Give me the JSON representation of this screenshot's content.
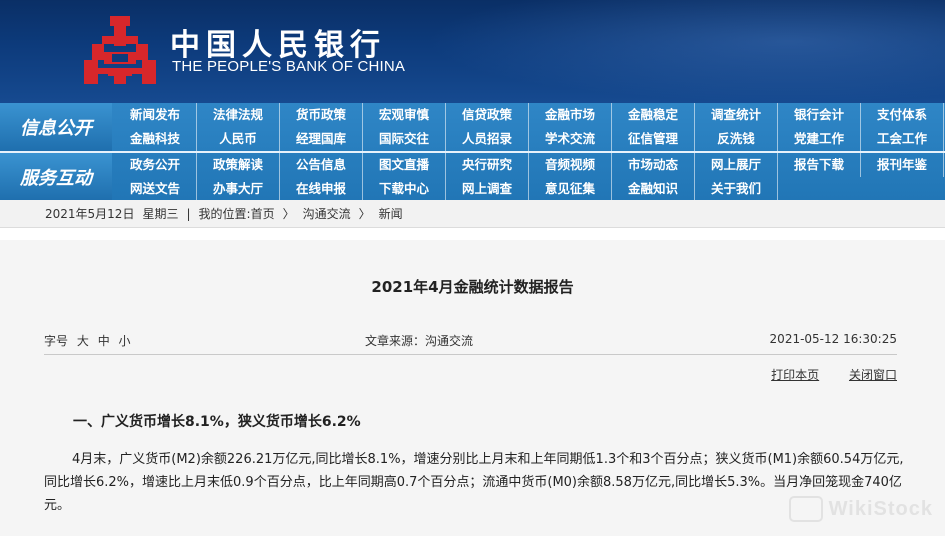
{
  "brand": {
    "name_cn": "中国人民银行",
    "name_en": "THE PEOPLE'S BANK OF CHINA"
  },
  "nav": {
    "section1_label": "信息公开",
    "section2_label": "服务互动",
    "row1": [
      "新闻发布",
      "法律法规",
      "货币政策",
      "宏观审慎",
      "信贷政策",
      "金融市场",
      "金融稳定",
      "调查统计",
      "银行会计",
      "支付体系"
    ],
    "row2": [
      "金融科技",
      "人民币",
      "经理国库",
      "国际交往",
      "人员招录",
      "学术交流",
      "征信管理",
      "反洗钱",
      "党建工作",
      "工会工作"
    ],
    "row3": [
      "政务公开",
      "政策解读",
      "公告信息",
      "图文直播",
      "央行研究",
      "音频视频",
      "市场动态",
      "网上展厅",
      "报告下载",
      "报刊年鉴"
    ],
    "row4": [
      "网送文告",
      "办事大厅",
      "在线申报",
      "下载中心",
      "网上调查",
      "意见征集",
      "金融知识",
      "关于我们",
      "",
      ""
    ]
  },
  "breadcrumb": {
    "date": "2021年5月12日",
    "weekday": "星期三",
    "divider": "|",
    "location_label": "我的位置:",
    "home": "首页",
    "sep1": "〉",
    "level1": "沟通交流",
    "sep2": "〉",
    "level2": "新闻"
  },
  "article": {
    "title": "2021年4月金融统计数据报告",
    "font_size_label": "字号",
    "font_large": "大",
    "font_medium": "中",
    "font_small": "小",
    "source": "文章来源：沟通交流",
    "datetime": "2021-05-12  16:30:25",
    "print_label": "打印本页",
    "close_label": "关闭窗口",
    "heading1": "一、广义货币增长8.1%，狭义货币增长6.2%",
    "paragraph1": "4月末，广义货币(M2)余额226.21万亿元,同比增长8.1%，增速分别比上月末和上年同期低1.3个和3个百分点；狭义货币(M1)余额60.54万亿元,同比增长6.2%，增速比上月末低0.9个百分点，比上年同期高0.7个百分点；流通中货币(M0)余额8.58万亿元,同比增长5.3%。当月净回笼现金740亿元。"
  },
  "watermark": {
    "text": "WikiStock"
  },
  "colors": {
    "header_bg": "#0d3b7c",
    "nav_bg": "#2176b6",
    "logo_red": "#d7272b",
    "page_bg": "#f5f5f5"
  }
}
